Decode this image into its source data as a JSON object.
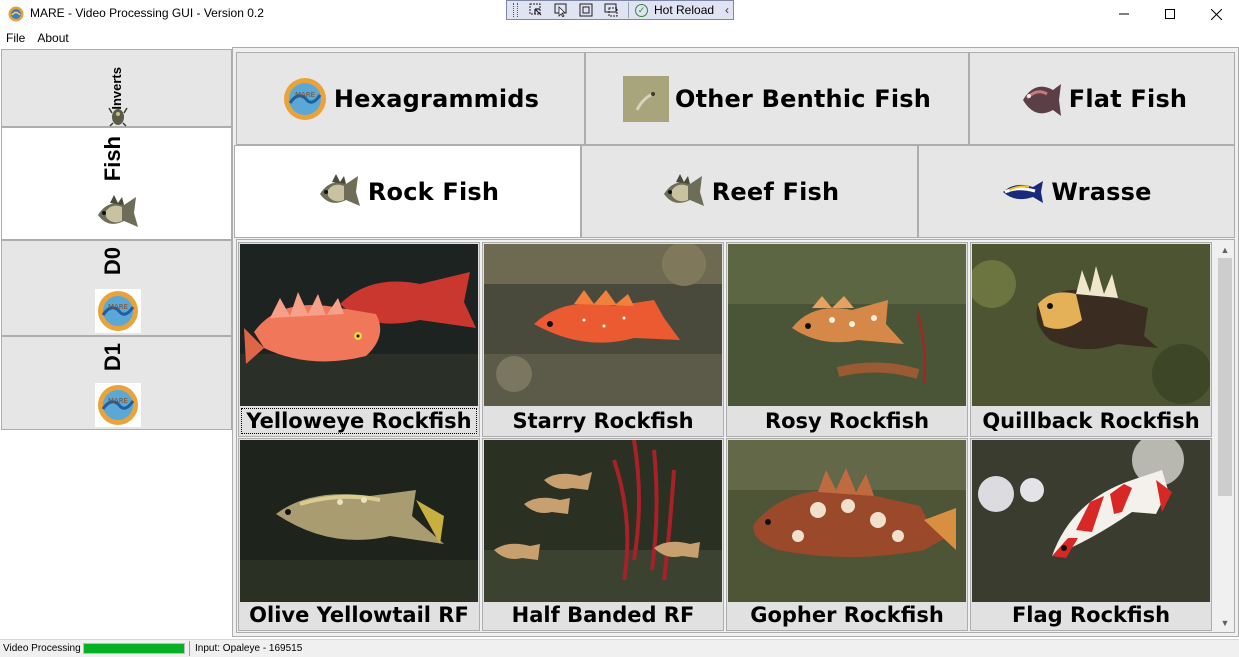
{
  "window": {
    "title": "MARE - Video Processing GUI - Version 0.2",
    "controls": {
      "minimize": "minimize",
      "maximize": "maximize",
      "close": "close"
    }
  },
  "debug_toolbar": {
    "hot_reload_label": "Hot Reload",
    "icons": [
      "select-element-icon",
      "cursor-icon",
      "layout-adorner-icon",
      "track-focus-icon"
    ]
  },
  "menu": {
    "items": [
      {
        "label": "File"
      },
      {
        "label": "About"
      }
    ]
  },
  "sidebar": {
    "items": [
      {
        "label": "Inverts",
        "icon": "invert-creature-icon",
        "active": false
      },
      {
        "label": "Fish",
        "icon": "fish-icon",
        "active": true
      },
      {
        "label": "D0",
        "icon": "mare-logo-icon",
        "active": false
      },
      {
        "label": "D1",
        "icon": "mare-logo-icon",
        "active": false
      }
    ]
  },
  "categories": {
    "row1": [
      {
        "label": "Hexagrammids",
        "icon": "mare-logo-icon"
      },
      {
        "label": "Other Benthic Fish",
        "icon": "benthic-fish-icon"
      },
      {
        "label": "Flat Fish",
        "icon": "flatfish-icon"
      }
    ],
    "row2": [
      {
        "label": "Rock Fish",
        "icon": "rockfish-icon",
        "active": true
      },
      {
        "label": "Reef Fish",
        "icon": "reef-fish-icon"
      },
      {
        "label": "Wrasse",
        "icon": "wrasse-icon"
      }
    ]
  },
  "species": [
    {
      "label": "Yelloweye Rockfish",
      "focused": true
    },
    {
      "label": "Starry Rockfish"
    },
    {
      "label": "Rosy Rockfish"
    },
    {
      "label": "Quillback Rockfish"
    },
    {
      "label": "Olive Yellowtail RF"
    },
    {
      "label": "Half Banded RF"
    },
    {
      "label": "Gopher Rockfish"
    },
    {
      "label": "Flag Rockfish"
    }
  ],
  "status": {
    "label": "Video Processing",
    "progress": 1.0,
    "input": "Input: Opaleye - 169515"
  },
  "colors": {
    "progress_fill": "#06b025",
    "button_face": "#e6e6e6",
    "button_border": "#adadad"
  }
}
